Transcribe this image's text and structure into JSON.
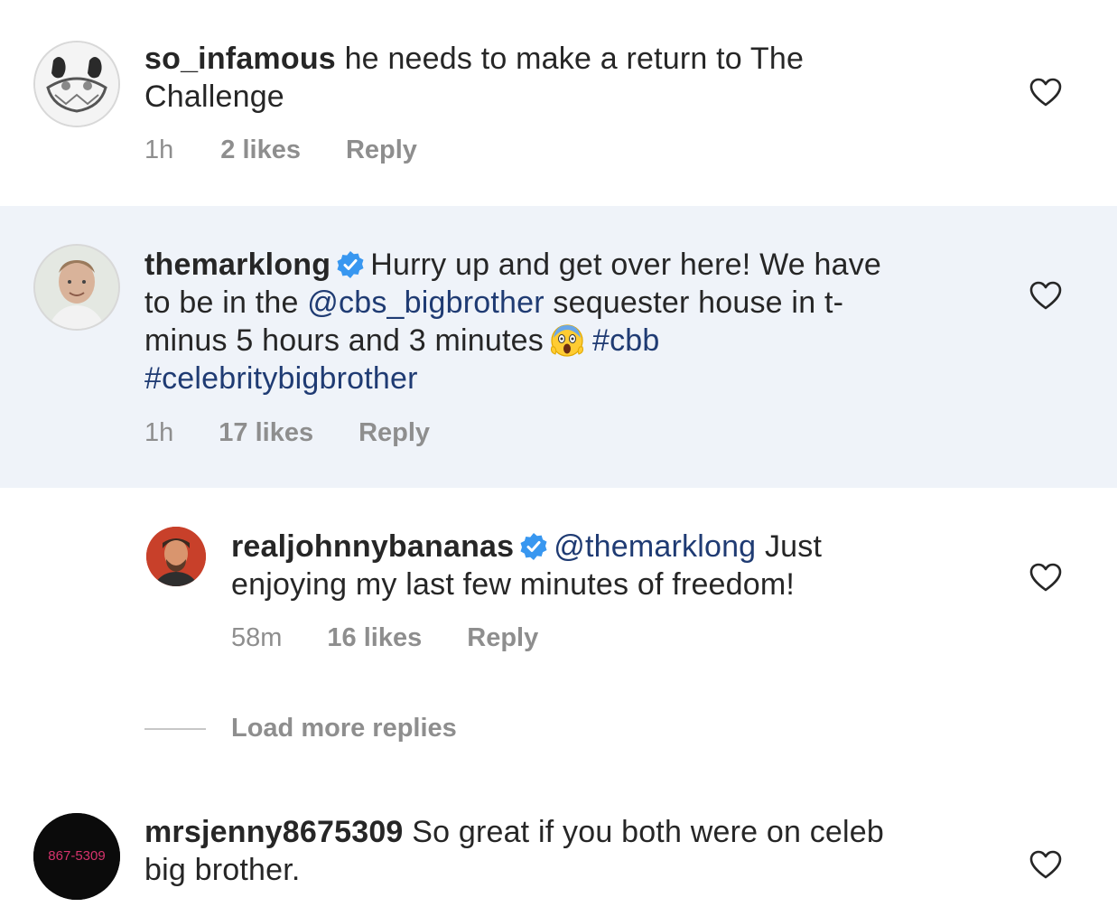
{
  "comments": [
    {
      "username": "so_infamous",
      "text_parts": [
        "he needs to make a return to The",
        "Challenge"
      ],
      "time": "1h",
      "likes": "2 likes",
      "reply": "Reply"
    },
    {
      "username": "themarklong",
      "verified": true,
      "line1_text": "Hurry up and get over here! We have",
      "line2_pre": "to be in the",
      "line2_mention": "@cbs_bigbrother",
      "line2_post": "sequester house in t-",
      "line3_pre": "minus 5 hours and 3 minutes",
      "line3_hashtag": "#cbb",
      "line4_hashtag": "#celebritybigbrother",
      "emoji": "face-screaming-in-fear",
      "time": "1h",
      "likes": "17 likes",
      "reply": "Reply"
    },
    {
      "username": "realjohnnybananas",
      "verified": true,
      "mention": "@themarklong",
      "line1_post": "Just",
      "line2": "enjoying my last few minutes of freedom!",
      "time": "58m",
      "likes": "16 likes",
      "reply": "Reply"
    },
    {
      "username": "mrsjenny8675309",
      "line1_post": "So great if you both were on celeb",
      "line2": "big brother.",
      "avatar_text": "867-5309"
    }
  ],
  "load_more": "Load more replies",
  "colors": {
    "highlight_bg": "#eff3f9",
    "link": "#1f3b73",
    "meta": "#8e8e8e",
    "verified": "#3897f0"
  },
  "icons": [
    "heart-icon",
    "verified-badge-icon",
    "scream-emoji-icon"
  ]
}
